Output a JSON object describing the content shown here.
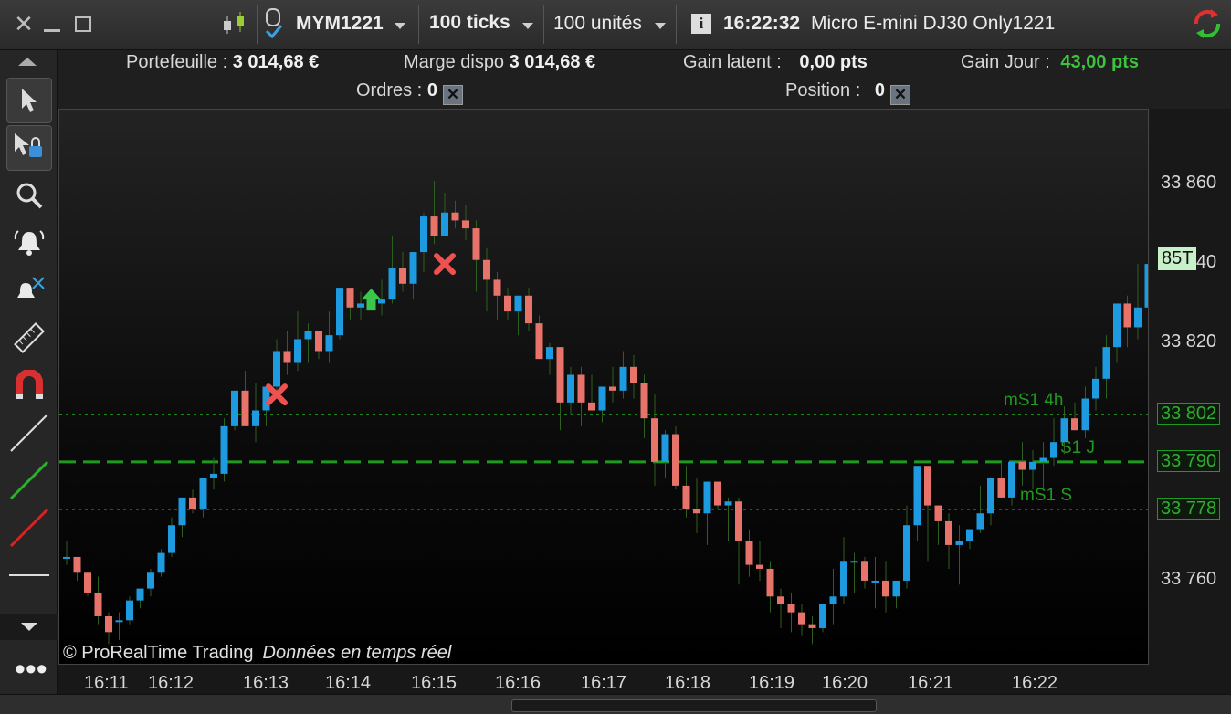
{
  "window": {
    "icon_names": [
      "close-icon",
      "minimize-icon",
      "maximize-icon"
    ]
  },
  "toolbar_top": {
    "instrument": "MYM1221",
    "ticks": "100 ticks",
    "units": "100 unités",
    "time": "16:22:32",
    "description": "Micro E-mini DJ30 Only1221"
  },
  "account": {
    "portefeuille_label": "Portefeuille :",
    "portefeuille_value": "3 014,68 €",
    "marge_label": "Marge dispo",
    "marge_value": "3 014,68 €",
    "gain_latent_label": "Gain latent :",
    "gain_latent_value": "0,00 pts",
    "gain_jour_label": "Gain Jour :",
    "gain_jour_value": "43,00 pts",
    "ordres_label": "Ordres :",
    "ordres_value": "0",
    "position_label": "Position :",
    "position_value": "0",
    "gain_color": "#3cc43c"
  },
  "watermark": {
    "brand": "© ProRealTime Trading",
    "data_note": "Données en temps réel"
  },
  "chart_data": {
    "type": "candlestick",
    "x_tick_labels": [
      "16:11",
      "16:12",
      "16:13",
      "16:14",
      "16:15",
      "16:16",
      "16:17",
      "16:18",
      "16:19",
      "16:20",
      "16:21",
      "16:22"
    ],
    "y_tick_labels": [
      "33 860",
      "33 840",
      "33 820",
      "33 760"
    ],
    "ylim": [
      33739,
      33879
    ],
    "last_label": "85T",
    "up_color": "#1e9be0",
    "down_color": "#e8736a",
    "candles": [
      [
        33766,
        33770,
        33764,
        33766
      ],
      [
        33766,
        33765,
        33760,
        33762
      ],
      [
        33762,
        33762,
        33756,
        33757
      ],
      [
        33757,
        33761,
        33749,
        33751
      ],
      [
        33751,
        33752,
        33744,
        33747
      ],
      [
        33750,
        33752,
        33745,
        33750
      ],
      [
        33750,
        33756,
        33749,
        33755
      ],
      [
        33755,
        33758,
        33753,
        33758
      ],
      [
        33758,
        33763,
        33756,
        33762
      ],
      [
        33762,
        33768,
        33761,
        33767
      ],
      [
        33767,
        33776,
        33766,
        33774
      ],
      [
        33774,
        33781,
        33771,
        33781
      ],
      [
        33781,
        33783,
        33777,
        33778
      ],
      [
        33778,
        33786,
        33776,
        33786
      ],
      [
        33786,
        33791,
        33783,
        33787
      ],
      [
        33787,
        33801,
        33785,
        33799
      ],
      [
        33799,
        33806,
        33798,
        33808
      ],
      [
        33808,
        33813,
        33801,
        33799
      ],
      [
        33799,
        33810,
        33795,
        33803
      ],
      [
        33803,
        33807,
        33799,
        33809
      ],
      [
        33809,
        33821,
        33806,
        33818
      ],
      [
        33818,
        33823,
        33812,
        33815
      ],
      [
        33815,
        33828,
        33813,
        33821
      ],
      [
        33821,
        33825,
        33815,
        33823
      ],
      [
        33823,
        33819,
        33816,
        33818
      ],
      [
        33818,
        33828,
        33815,
        33822
      ],
      [
        33822,
        33833,
        33821,
        33834
      ],
      [
        33834,
        33833,
        33826,
        33829
      ],
      [
        33829,
        33833,
        33826,
        33830
      ],
      [
        33830,
        33831,
        33829,
        33830
      ],
      [
        33830,
        33836,
        33827,
        33831
      ],
      [
        33831,
        33847,
        33830,
        33839
      ],
      [
        33839,
        33843,
        33833,
        33835
      ],
      [
        33835,
        33841,
        33831,
        33843
      ],
      [
        33843,
        33853,
        33838,
        33852
      ],
      [
        33852,
        33861,
        33845,
        33847
      ],
      [
        33847,
        33858,
        33852,
        33853
      ],
      [
        33853,
        33856,
        33849,
        33851
      ],
      [
        33851,
        33855,
        33846,
        33849
      ],
      [
        33849,
        33851,
        33833,
        33841
      ],
      [
        33841,
        33844,
        33828,
        33836
      ],
      [
        33836,
        33838,
        33826,
        33832
      ],
      [
        33832,
        33834,
        33826,
        33828
      ],
      [
        33828,
        33832,
        33822,
        33832
      ],
      [
        33832,
        33834,
        33823,
        33825
      ],
      [
        33825,
        33827,
        33816,
        33816
      ],
      [
        33816,
        33820,
        33812,
        33819
      ],
      [
        33819,
        33818,
        33798,
        33805
      ],
      [
        33805,
        33814,
        33802,
        33812
      ],
      [
        33812,
        33814,
        33799,
        33805
      ],
      [
        33805,
        33812,
        33803,
        33803
      ],
      [
        33803,
        33805,
        33800,
        33809
      ],
      [
        33809,
        33814,
        33805,
        33808
      ],
      [
        33808,
        33818,
        33806,
        33814
      ],
      [
        33814,
        33817,
        33806,
        33810
      ],
      [
        33810,
        33812,
        33796,
        33801
      ],
      [
        33801,
        33807,
        33784,
        33790
      ],
      [
        33790,
        33798,
        33786,
        33797
      ],
      [
        33797,
        33799,
        33783,
        33784
      ],
      [
        33784,
        33789,
        33776,
        33778
      ],
      [
        33778,
        33786,
        33772,
        33777
      ],
      [
        33777,
        33778,
        33769,
        33785
      ],
      [
        33785,
        33779,
        33778,
        33779
      ],
      [
        33779,
        33781,
        33770,
        33780
      ],
      [
        33780,
        33781,
        33759,
        33770
      ],
      [
        33770,
        33773,
        33761,
        33764
      ],
      [
        33764,
        33770,
        33760,
        33763
      ],
      [
        33763,
        33765,
        33752,
        33756
      ],
      [
        33756,
        33758,
        33748,
        33754
      ],
      [
        33754,
        33757,
        33747,
        33752
      ],
      [
        33752,
        33754,
        33746,
        33749
      ],
      [
        33749,
        33751,
        33744,
        33748
      ],
      [
        33748,
        33753,
        33747,
        33754
      ],
      [
        33754,
        33763,
        33749,
        33756
      ],
      [
        33756,
        33771,
        33754,
        33765
      ],
      [
        33765,
        33767,
        33757,
        33765
      ],
      [
        33765,
        33766,
        33758,
        33760
      ],
      [
        33760,
        33766,
        33753,
        33760
      ],
      [
        33760,
        33765,
        33752,
        33756
      ],
      [
        33756,
        33760,
        33753,
        33760
      ],
      [
        33760,
        33779,
        33758,
        33774
      ],
      [
        33774,
        33783,
        33770,
        33789
      ],
      [
        33789,
        33785,
        33765,
        33779
      ],
      [
        33779,
        33779,
        33769,
        33775
      ],
      [
        33775,
        33777,
        33763,
        33769
      ],
      [
        33769,
        33774,
        33759,
        33770
      ],
      [
        33770,
        33772,
        33768,
        33773
      ],
      [
        33773,
        33784,
        33772,
        33777
      ],
      [
        33777,
        33786,
        33774,
        33786
      ],
      [
        33786,
        33790,
        33783,
        33781
      ],
      [
        33781,
        33790,
        33779,
        33790
      ],
      [
        33790,
        33795,
        33784,
        33788
      ],
      [
        33788,
        33793,
        33783,
        33790
      ],
      [
        33790,
        33795,
        33783,
        33791
      ],
      [
        33791,
        33801,
        33789,
        33795
      ],
      [
        33795,
        33804,
        33792,
        33801
      ],
      [
        33801,
        33805,
        33798,
        33798
      ],
      [
        33798,
        33809,
        33796,
        33806
      ],
      [
        33806,
        33814,
        33803,
        33811
      ],
      [
        33811,
        33822,
        33806,
        33819
      ],
      [
        33819,
        33830,
        33815,
        33830
      ],
      [
        33830,
        33832,
        33819,
        33824
      ],
      [
        33824,
        33840,
        33821,
        33829
      ],
      [
        33829,
        33838,
        33826,
        33840
      ],
      [
        33840,
        33848,
        33835,
        33849
      ],
      [
        33849,
        33851,
        33839,
        33841
      ]
    ],
    "levels": [
      {
        "name": "mS1 4h",
        "value": 33802,
        "label": "33 802",
        "style": "dotted"
      },
      {
        "name": "S1 J",
        "value": 33790,
        "label": "33 790",
        "style": "dashed"
      },
      {
        "name": "mS1 S",
        "value": 33778,
        "label": "33 778",
        "style": "dotted"
      }
    ],
    "markers": [
      {
        "type": "sell-exit",
        "index": 20,
        "price": 33807
      },
      {
        "type": "buy-entry",
        "index": 29,
        "price": 33831
      },
      {
        "type": "sell-exit",
        "index": 36,
        "price": 33840
      }
    ]
  }
}
